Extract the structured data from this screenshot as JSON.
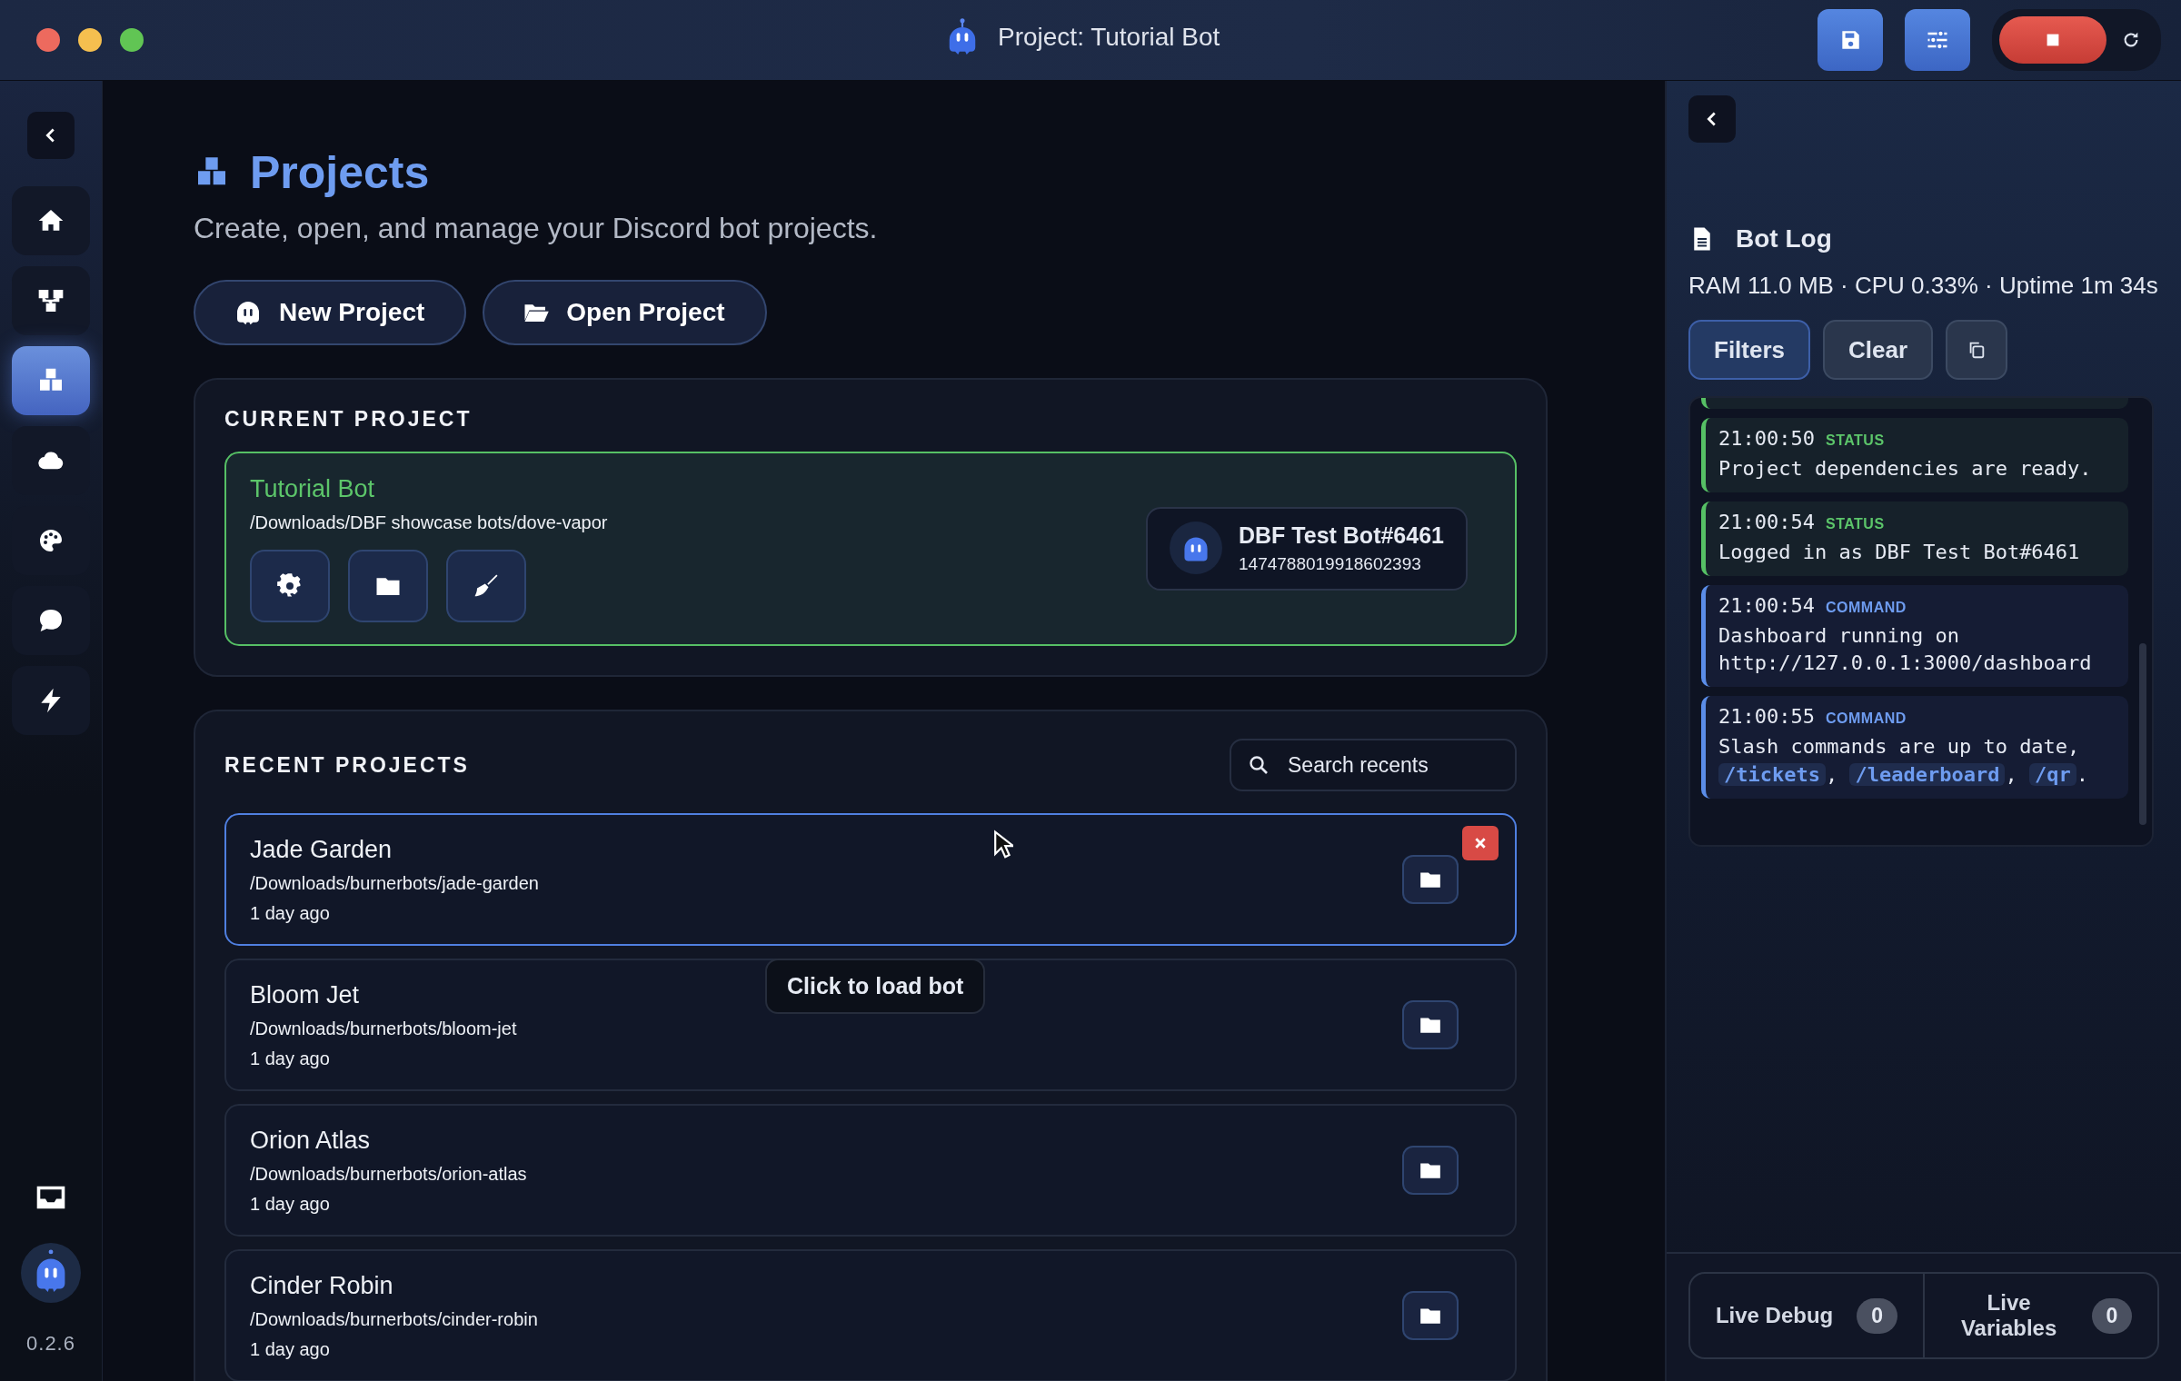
{
  "window": {
    "title": "Project: Tutorial Bot"
  },
  "toolbar": {
    "bot_running": true
  },
  "sidebar": {
    "items": [
      {
        "kind": "home",
        "selected": false
      },
      {
        "kind": "flow",
        "selected": false
      },
      {
        "kind": "projects",
        "selected": true
      },
      {
        "kind": "cloud",
        "selected": false
      },
      {
        "kind": "palette",
        "selected": false
      },
      {
        "kind": "chat",
        "selected": false
      },
      {
        "kind": "bolt",
        "selected": false
      }
    ],
    "version": "0.2.6"
  },
  "page": {
    "title": "Projects",
    "subtitle": "Create, open, and manage your Discord bot projects.",
    "actions": [
      {
        "kind": "new",
        "label": "New Project"
      },
      {
        "kind": "open",
        "label": "Open Project"
      }
    ]
  },
  "current_project": {
    "heading": "CURRENT PROJECT",
    "name": "Tutorial Bot",
    "path": "/Downloads/DBF showcase bots/dove-vapor",
    "bot": {
      "name": "DBF Test Bot#6461",
      "id": "1474788019918602393"
    }
  },
  "recent_projects": {
    "heading": "RECENT PROJECTS",
    "search": {
      "placeholder": "Search recents"
    },
    "tooltip": "Click to load bot",
    "items": [
      {
        "name": "Jade Garden",
        "path": "/Downloads/burnerbots/jade-garden",
        "age": "1 day ago",
        "selected": true
      },
      {
        "name": "Bloom Jet",
        "path": "/Downloads/burnerbots/bloom-jet",
        "age": "1 day ago",
        "selected": false
      },
      {
        "name": "Orion Atlas",
        "path": "/Downloads/burnerbots/orion-atlas",
        "age": "1 day ago",
        "selected": false
      },
      {
        "name": "Cinder Robin",
        "path": "/Downloads/burnerbots/cinder-robin",
        "age": "1 day ago",
        "selected": false
      }
    ]
  },
  "bot_log": {
    "title": "Bot Log",
    "stats": "RAM 11.0 MB · CPU 0.33% · Uptime 1m 34s",
    "buttons": [
      {
        "label": "Filters",
        "selected": true
      },
      {
        "label": "Clear",
        "selected": false
      }
    ],
    "entries": [
      {
        "time": "21:00:50",
        "kind": "status",
        "tag": "STATUS",
        "parts": [
          {
            "kind": "text",
            "text": "Project dependencies are ready."
          }
        ]
      },
      {
        "time": "21:00:54",
        "kind": "status",
        "tag": "STATUS",
        "parts": [
          {
            "kind": "text",
            "text": "Logged in as DBF Test Bot#6461"
          }
        ]
      },
      {
        "time": "21:00:54",
        "kind": "command",
        "tag": "COMMAND",
        "parts": [
          {
            "kind": "text",
            "text": "Dashboard running on http://127.0.0.1:3000/dashboard"
          }
        ]
      },
      {
        "time": "21:00:55",
        "kind": "command",
        "tag": "COMMAND",
        "parts": [
          {
            "kind": "text",
            "text": "Slash commands are up to date, "
          },
          {
            "kind": "code",
            "text": "/tickets"
          },
          {
            "kind": "text",
            "text": ", "
          },
          {
            "kind": "code",
            "text": "/leaderboard"
          },
          {
            "kind": "text",
            "text": ", "
          },
          {
            "kind": "code",
            "text": "/qr"
          },
          {
            "kind": "text",
            "text": "."
          }
        ]
      }
    ]
  },
  "debug_panels": [
    {
      "label": "Live Debug",
      "count": "0"
    },
    {
      "label": "Live Variables",
      "count": "0"
    }
  ]
}
